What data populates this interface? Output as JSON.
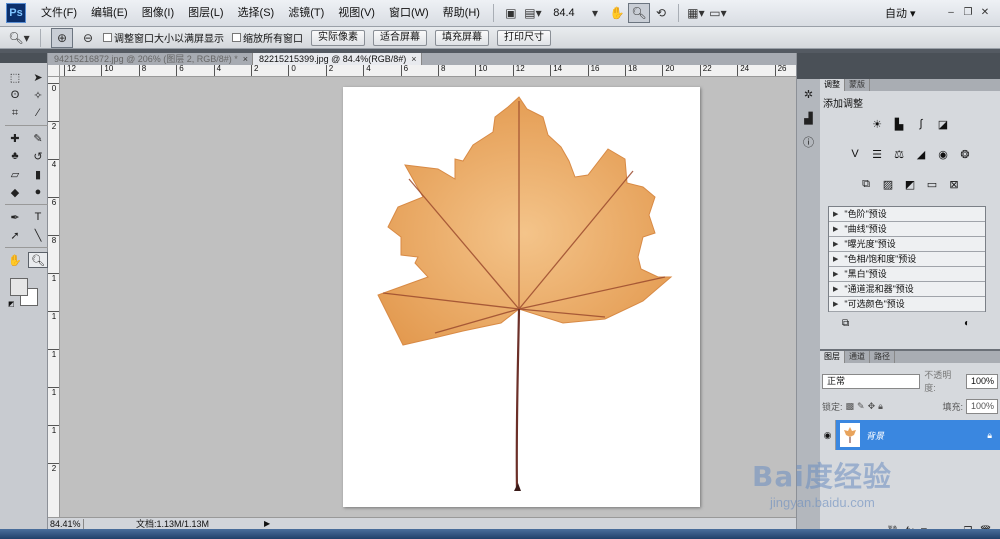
{
  "app": {
    "logo": "Ps",
    "workspace": "自动"
  },
  "menu": [
    "文件(F)",
    "编辑(E)",
    "图像(I)",
    "图层(L)",
    "选择(S)",
    "滤镜(T)",
    "视图(V)",
    "窗口(W)",
    "帮助(H)"
  ],
  "zoom_readout": "84.4",
  "options": {
    "resize_windows": "调整窗口大小以满屏显示",
    "zoom_all": "缩放所有窗口",
    "actual_pixels": "实际像素",
    "fit_screen": "适合屏幕",
    "fill_screen": "填充屏幕",
    "print_size": "打印尺寸"
  },
  "tabs": [
    {
      "title": "94215216872.jpg @ 206% (图层 2, RGB/8#) *",
      "active": false
    },
    {
      "title": "82215215399.jpg @ 84.4%(RGB/8#)",
      "active": true
    }
  ],
  "ruler_h": [
    "12",
    "10",
    "8",
    "6",
    "4",
    "2",
    "0",
    "2",
    "4",
    "6",
    "8",
    "10",
    "12",
    "14",
    "16",
    "18",
    "20",
    "22",
    "24",
    "26"
  ],
  "ruler_v": [
    "0",
    "2",
    "4",
    "6",
    "8",
    "1",
    "1",
    "1",
    "1",
    "1",
    "2"
  ],
  "status": {
    "zoom": "84.41%",
    "doc": "文档:1.13M/1.13M"
  },
  "adjust_panel": {
    "tabs": [
      "调整",
      "蒙版"
    ],
    "title": "添加调整",
    "presets": [
      "\"色阶\"预设",
      "\"曲线\"预设",
      "\"曝光度\"预设",
      "\"色相/饱和度\"预设",
      "\"黑白\"预设",
      "\"通道混和器\"预设",
      "\"可选颜色\"预设"
    ]
  },
  "layers_panel": {
    "tabs": [
      "图层",
      "通道",
      "路径"
    ],
    "blend_mode": "正常",
    "opacity_label": "不透明度:",
    "opacity": "100%",
    "lock_label": "锁定:",
    "fill_label": "填充:",
    "fill": "100%",
    "layer_name": "背景"
  },
  "watermark": {
    "main": "Bai度经验",
    "sub": "jingyan.baidu.com"
  },
  "colors": {
    "accent_layer": "#3a87e0",
    "leaf": "#e8a35c",
    "vein": "#7a3a2a"
  }
}
